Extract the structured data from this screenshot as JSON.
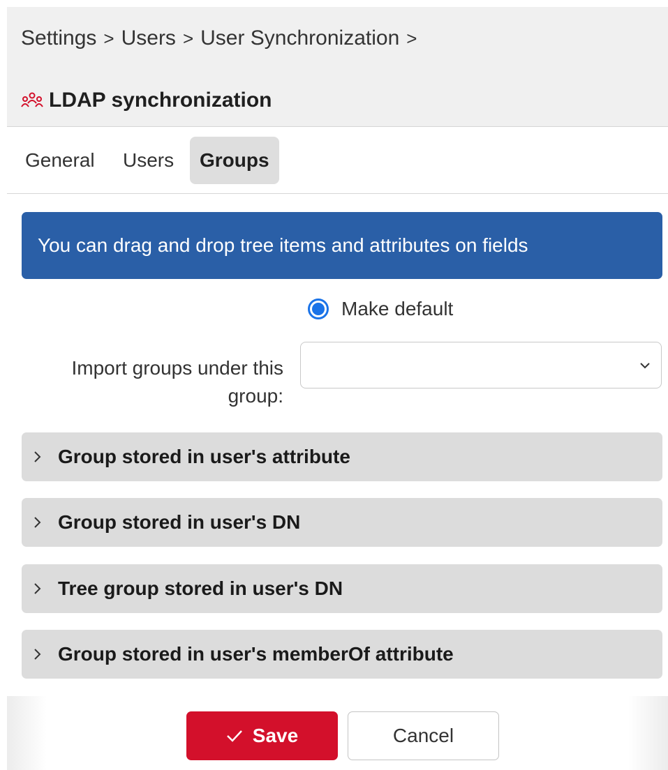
{
  "breadcrumb": {
    "items": [
      "Settings",
      "Users",
      "User Synchronization"
    ],
    "separator": ">"
  },
  "page": {
    "title": "LDAP synchronization",
    "title_icon": "users-group-icon",
    "accent_color": "#d3102b"
  },
  "tabs": [
    {
      "label": "General",
      "active": false
    },
    {
      "label": "Users",
      "active": false
    },
    {
      "label": "Groups",
      "active": true
    }
  ],
  "info_banner": {
    "text": "You can drag and drop tree items and attributes on fields",
    "color": "#2a5fa7"
  },
  "make_default": {
    "label": "Make default",
    "selected": true
  },
  "import_group": {
    "label": "Import groups under this group:",
    "value": ""
  },
  "sections": [
    {
      "label": "Group stored in user's attribute",
      "expanded": false
    },
    {
      "label": "Group stored in user's DN",
      "expanded": false
    },
    {
      "label": "Tree group stored in user's DN",
      "expanded": false
    },
    {
      "label": "Group stored in user's memberOf attribute",
      "expanded": false
    }
  ],
  "actions": {
    "save_label": "Save",
    "cancel_label": "Cancel"
  }
}
